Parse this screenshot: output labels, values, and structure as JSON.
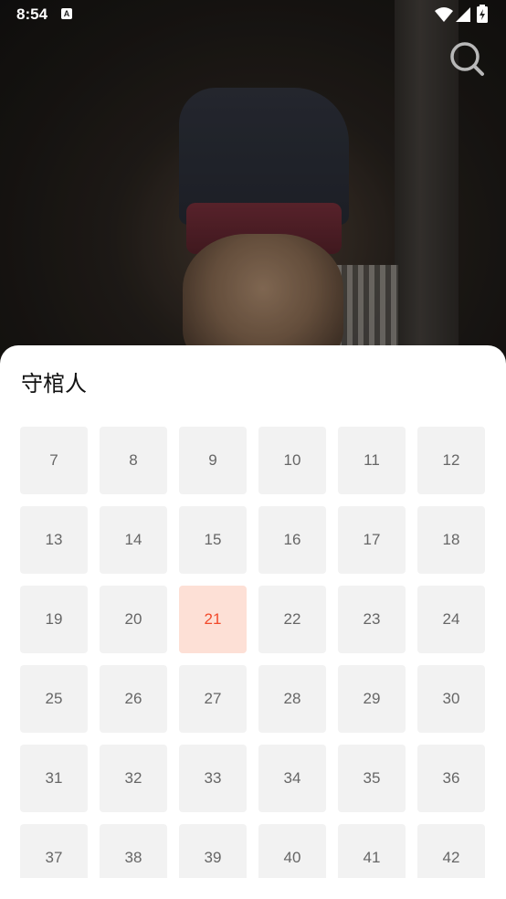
{
  "status_bar": {
    "time": "8:54",
    "a_icon": "A",
    "icons": [
      "wifi-icon",
      "signal-icon",
      "battery-charging-icon"
    ]
  },
  "video": {
    "search_icon": "search-icon"
  },
  "sheet": {
    "title": "守棺人",
    "episodes": [
      "7",
      "8",
      "9",
      "10",
      "11",
      "12",
      "13",
      "14",
      "15",
      "16",
      "17",
      "18",
      "19",
      "20",
      "21",
      "22",
      "23",
      "24",
      "25",
      "26",
      "27",
      "28",
      "29",
      "30",
      "31",
      "32",
      "33",
      "34",
      "35",
      "36",
      "37",
      "38",
      "39",
      "40",
      "41",
      "42"
    ],
    "selected_episode": "21",
    "colors": {
      "selected_bg": "#fde0d6",
      "selected_text": "#f2492a",
      "tile_bg": "#f2f2f2",
      "tile_text": "#666666"
    }
  }
}
